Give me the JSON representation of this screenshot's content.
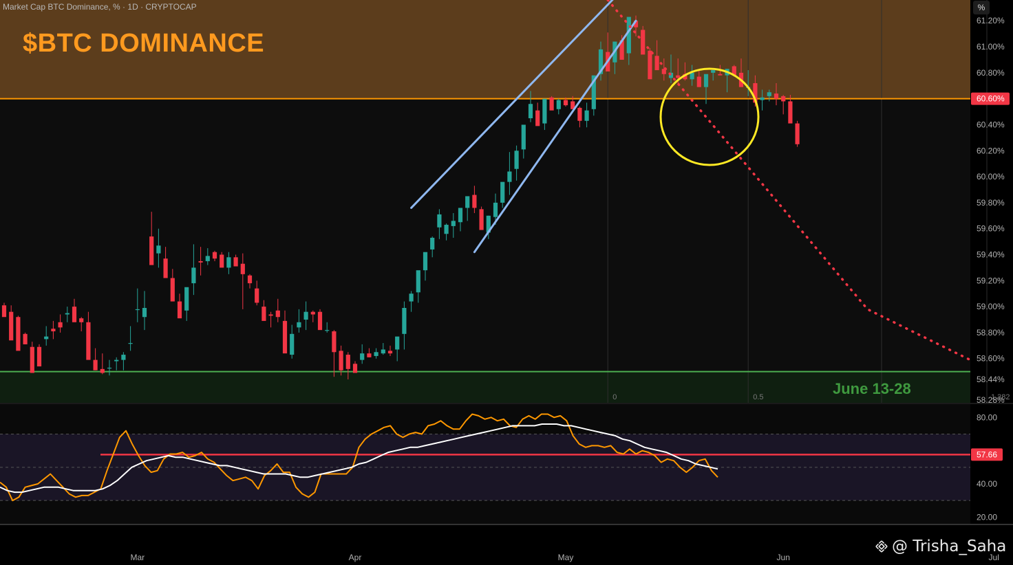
{
  "header": {
    "symbol_line": "Market Cap BTC Dominance, % · 1D · CRYPTOCAP",
    "unit_button": "%"
  },
  "annotation_title": "$BTC DOMINANCE",
  "annotation_date_range": "June 13-28",
  "watermark": "@ Trisha_Saha",
  "colors": {
    "up": "#26a69a",
    "down": "#f23645",
    "resistance": "#ff9800",
    "support": "#4caf50",
    "channel": "#8fb8f0",
    "projection": "#f23645",
    "circle": "#ffe924",
    "rsi": "#ff9800",
    "rsi_ma": "#ffffff",
    "rsi_level": "#f23645"
  },
  "chart_data": [
    {
      "type": "candlestick",
      "title": "Market Cap BTC Dominance, % · 1D · CRYPTOCAP",
      "x_labels": [
        "Mar",
        "Apr",
        "May",
        "Jun",
        "Jul"
      ],
      "y_ticks": [
        "61.20%",
        "61.00%",
        "60.80%",
        "60.60%",
        "60.40%",
        "60.20%",
        "60.00%",
        "59.80%",
        "59.60%",
        "59.40%",
        "59.20%",
        "59.00%",
        "58.80%",
        "58.60%",
        "58.44%",
        "58.28%"
      ],
      "y_tick_values": [
        61.2,
        61.0,
        60.8,
        60.6,
        60.4,
        60.2,
        60.0,
        59.8,
        59.6,
        59.4,
        59.2,
        59.0,
        58.8,
        58.6,
        58.44,
        58.28
      ],
      "ylim": [
        58.26,
        61.36
      ],
      "grid": true,
      "resistance_level": {
        "value": 60.6,
        "label": "60.60%"
      },
      "support_level": {
        "value": 58.5
      },
      "fib_labels": [
        "0",
        "0.5",
        "1.382"
      ],
      "projection_target": {
        "date": "Jun 13-28",
        "label": "June 13-28"
      },
      "candles": [
        [
          59.01,
          59.03,
          58.97,
          58.92
        ],
        [
          58.96,
          59.01,
          58.92,
          58.74
        ],
        [
          58.92,
          58.93,
          58.91,
          58.66
        ],
        [
          58.79,
          58.8,
          58.71,
          58.71
        ],
        [
          58.69,
          58.73,
          58.54,
          58.49
        ],
        [
          58.69,
          58.71,
          58.56,
          58.54
        ],
        [
          58.75,
          58.85,
          58.7,
          58.77
        ],
        [
          58.83,
          58.89,
          58.75,
          58.81
        ],
        [
          58.88,
          58.94,
          58.8,
          58.84
        ],
        [
          58.94,
          59.0,
          58.88,
          58.95
        ],
        [
          59.0,
          59.06,
          58.9,
          58.88
        ],
        [
          58.91,
          58.92,
          58.81,
          58.88
        ],
        [
          58.88,
          58.96,
          58.84,
          58.59
        ],
        [
          58.59,
          58.68,
          58.51,
          58.51
        ],
        [
          58.52,
          58.64,
          58.48,
          58.49
        ],
        [
          58.53,
          58.59,
          58.47,
          58.53
        ],
        [
          58.58,
          58.61,
          58.51,
          58.59
        ],
        [
          58.59,
          58.65,
          58.51,
          58.63
        ],
        [
          58.72,
          58.85,
          58.66,
          58.72
        ],
        [
          58.98,
          59.14,
          58.88,
          58.98
        ],
        [
          58.92,
          59.12,
          58.82,
          58.99
        ],
        [
          59.54,
          59.73,
          59.45,
          59.32
        ],
        [
          59.41,
          59.6,
          59.3,
          59.47
        ],
        [
          59.37,
          59.46,
          59.3,
          59.22
        ],
        [
          59.22,
          59.29,
          59.13,
          59.04
        ],
        [
          59.04,
          59.1,
          58.95,
          58.91
        ],
        [
          58.97,
          59.1,
          58.89,
          59.15
        ],
        [
          59.18,
          59.48,
          59.09,
          59.3
        ],
        [
          59.35,
          59.46,
          59.24,
          59.34
        ],
        [
          59.35,
          59.45,
          59.32,
          59.39
        ],
        [
          59.42,
          59.43,
          59.35,
          59.37
        ],
        [
          59.4,
          59.42,
          59.37,
          59.3
        ],
        [
          59.3,
          59.42,
          59.25,
          59.38
        ],
        [
          59.38,
          59.4,
          59.32,
          59.31
        ],
        [
          59.33,
          59.41,
          58.98,
          59.25
        ],
        [
          59.24,
          59.25,
          59.14,
          59.18
        ],
        [
          59.14,
          59.2,
          59.01,
          59.03
        ],
        [
          59.0,
          59.05,
          58.93,
          58.89
        ],
        [
          58.94,
          58.96,
          58.84,
          58.93
        ],
        [
          58.97,
          59.06,
          58.88,
          58.92
        ],
        [
          58.89,
          58.97,
          58.8,
          58.64
        ],
        [
          58.63,
          58.86,
          58.6,
          58.79
        ],
        [
          58.84,
          58.98,
          58.8,
          58.88
        ],
        [
          58.9,
          59.04,
          58.82,
          58.96
        ],
        [
          58.96,
          58.97,
          58.88,
          58.94
        ],
        [
          58.96,
          58.98,
          58.93,
          58.82
        ],
        [
          58.82,
          58.88,
          58.8,
          58.82
        ],
        [
          58.81,
          58.82,
          58.46,
          58.65
        ],
        [
          58.66,
          58.7,
          58.47,
          58.51
        ],
        [
          58.63,
          58.65,
          58.44,
          58.52
        ],
        [
          58.56,
          58.58,
          58.53,
          58.49
        ],
        [
          58.59,
          58.71,
          58.56,
          58.64
        ],
        [
          58.64,
          58.68,
          58.61,
          58.61
        ],
        [
          58.62,
          58.68,
          58.6,
          58.65
        ],
        [
          58.64,
          58.72,
          58.63,
          58.67
        ],
        [
          58.66,
          58.7,
          58.62,
          58.64
        ],
        [
          58.67,
          58.71,
          58.58,
          58.77
        ],
        [
          58.79,
          59.04,
          58.67,
          58.99
        ],
        [
          59.04,
          59.12,
          58.96,
          59.1
        ],
        [
          59.11,
          59.17,
          59.03,
          59.28
        ],
        [
          59.28,
          59.34,
          59.2,
          59.42
        ],
        [
          59.44,
          59.54,
          59.38,
          59.53
        ],
        [
          59.61,
          59.75,
          59.52,
          59.71
        ],
        [
          59.56,
          59.64,
          59.51,
          59.63
        ],
        [
          59.62,
          59.72,
          59.53,
          59.66
        ],
        [
          59.65,
          59.73,
          59.58,
          59.76
        ],
        [
          59.76,
          59.82,
          59.66,
          59.85
        ],
        [
          59.86,
          59.93,
          59.72,
          59.76
        ],
        [
          59.75,
          59.77,
          59.6,
          59.59
        ],
        [
          59.57,
          59.7,
          59.52,
          59.7
        ],
        [
          59.69,
          59.87,
          59.63,
          59.8
        ],
        [
          59.8,
          59.93,
          59.76,
          59.96
        ],
        [
          59.96,
          60.19,
          59.86,
          60.04
        ],
        [
          60.06,
          60.24,
          59.97,
          60.2
        ],
        [
          60.21,
          60.37,
          60.14,
          60.4
        ],
        [
          60.45,
          60.66,
          60.42,
          60.56
        ],
        [
          60.51,
          60.57,
          60.4,
          60.39
        ],
        [
          60.41,
          60.56,
          60.36,
          60.6
        ],
        [
          60.61,
          60.62,
          60.55,
          60.51
        ],
        [
          60.52,
          60.6,
          60.48,
          60.59
        ],
        [
          60.59,
          60.61,
          60.54,
          60.55
        ],
        [
          60.58,
          60.62,
          60.58,
          60.52
        ],
        [
          60.53,
          60.54,
          60.38,
          60.43
        ],
        [
          60.43,
          60.57,
          60.38,
          60.51
        ],
        [
          60.52,
          60.71,
          60.47,
          60.78
        ],
        [
          60.79,
          61.04,
          60.74,
          60.98
        ],
        [
          60.96,
          61.11,
          60.93,
          60.81
        ],
        [
          60.88,
          61.04,
          60.79,
          61.04
        ],
        [
          61.05,
          61.09,
          60.93,
          60.9
        ],
        [
          60.95,
          61.16,
          60.86,
          61.23
        ],
        [
          61.2,
          61.24,
          61.08,
          61.15
        ],
        [
          61.13,
          61.16,
          60.95,
          60.94
        ],
        [
          60.97,
          60.99,
          60.82,
          60.75
        ],
        [
          60.93,
          61.05,
          60.84,
          60.82
        ],
        [
          60.83,
          60.91,
          60.74,
          60.79
        ],
        [
          60.76,
          60.94,
          60.72,
          60.8
        ],
        [
          60.78,
          60.91,
          60.72,
          60.76
        ],
        [
          60.79,
          60.88,
          60.74,
          60.75
        ],
        [
          60.75,
          60.86,
          60.7,
          60.8
        ],
        [
          60.77,
          60.82,
          60.69,
          60.69
        ],
        [
          60.69,
          60.72,
          60.56,
          60.79
        ],
        [
          60.8,
          60.83,
          60.74,
          60.82
        ],
        [
          60.79,
          60.86,
          60.78,
          60.78
        ],
        [
          60.78,
          60.83,
          60.65,
          60.83
        ],
        [
          60.85,
          60.86,
          60.79,
          60.78
        ],
        [
          60.8,
          60.91,
          60.78,
          60.69
        ],
        [
          60.69,
          60.82,
          60.62,
          60.69
        ],
        [
          60.72,
          60.78,
          60.54,
          60.57
        ],
        [
          60.59,
          60.67,
          60.51,
          60.61
        ],
        [
          60.62,
          60.67,
          60.58,
          60.65
        ],
        [
          60.64,
          60.72,
          60.55,
          60.6
        ],
        [
          60.62,
          60.63,
          60.48,
          60.58
        ],
        [
          60.58,
          60.63,
          60.52,
          60.41
        ],
        [
          60.41,
          60.43,
          60.23,
          60.25
        ]
      ],
      "channel_lines": [
        [
          {
            "date": "Apr 9",
            "value": 59.76
          },
          {
            "date": "May 8",
            "value": 61.38
          }
        ],
        [
          {
            "date": "Apr 18",
            "value": 59.42
          },
          {
            "date": "May 11",
            "value": 61.2
          }
        ]
      ],
      "projection_path": [
        {
          "date": "May 7",
          "value": 61.36
        },
        {
          "date": "Jun 13",
          "value": 58.98
        },
        {
          "date": "Jun 28",
          "value": 58.58
        }
      ]
    },
    {
      "type": "line",
      "title": "RSI",
      "y_ticks": [
        "80.00",
        "40.00",
        "20.00"
      ],
      "y_tick_values": [
        80,
        40,
        20
      ],
      "highlight_level": {
        "value": 57.66,
        "label": "57.66"
      },
      "dashed_levels": [
        70,
        50,
        30
      ],
      "ylim": [
        16,
        88
      ],
      "series": [
        {
          "color": "rsi",
          "values": [
            41,
            38,
            30,
            32,
            38,
            39,
            40,
            43,
            46,
            42,
            38,
            34,
            32,
            33,
            33,
            35,
            37,
            48,
            58,
            68,
            72,
            64,
            57,
            51,
            47,
            48,
            55,
            58,
            58,
            59,
            56,
            57,
            59,
            55,
            53,
            49,
            45,
            42,
            43,
            44,
            42,
            37,
            45,
            48,
            52,
            47,
            47,
            38,
            34,
            32,
            35,
            46,
            46,
            46,
            46,
            46,
            50,
            62,
            67,
            70,
            72,
            74,
            75,
            70,
            68,
            70,
            71,
            70,
            75,
            76,
            78,
            75,
            73,
            73,
            78,
            82,
            81,
            79,
            80,
            78,
            79,
            75,
            74,
            79,
            81,
            79,
            82,
            82,
            80,
            81,
            78,
            69,
            64,
            62,
            63,
            63,
            62,
            63,
            59,
            58,
            61,
            58,
            60,
            59,
            57,
            53,
            55,
            54,
            50,
            47,
            50,
            54,
            55,
            48,
            44
          ]
        },
        {
          "color": "rsi_ma",
          "values": [
            38,
            36,
            35,
            35,
            36,
            37,
            38,
            38,
            38,
            37,
            36,
            36,
            36,
            36,
            37,
            39,
            42,
            46,
            50,
            52,
            54,
            55,
            56,
            57,
            56,
            56,
            55,
            54,
            53,
            52,
            51,
            51,
            50,
            49,
            48,
            47,
            46,
            46,
            46,
            46,
            45,
            44,
            44,
            45,
            46,
            47,
            48,
            49,
            50,
            52,
            53,
            55,
            57,
            59,
            60,
            61,
            62,
            62,
            63,
            64,
            65,
            66,
            67,
            68,
            69,
            70,
            71,
            72,
            73,
            74,
            75,
            75,
            75,
            75,
            76,
            76,
            76,
            75,
            75,
            74,
            73,
            72,
            71,
            70,
            69,
            67,
            66,
            64,
            62,
            61,
            60,
            59,
            57,
            55,
            54,
            52,
            51,
            50,
            49
          ]
        }
      ]
    }
  ]
}
